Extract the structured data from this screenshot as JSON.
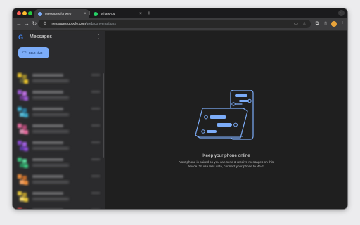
{
  "browser": {
    "tabs": [
      {
        "title": "Messages for web",
        "active": true,
        "favicon_color": "#7cacf8"
      },
      {
        "title": "WhatsApp",
        "active": false,
        "favicon_color": "#25d366"
      }
    ],
    "new_tab_icon": "+",
    "tab_menu_icon": "chevron-down-icon",
    "url_host": "messages.google.com",
    "url_path": "/web/conversations"
  },
  "app": {
    "logo": "G",
    "title": "Messages",
    "start_chat_label": "Start chat",
    "conversations": [
      {
        "colors": [
          "#e8c22b",
          "#a08a2a",
          "#5a5a3a"
        ]
      },
      {
        "colors": [
          "#9b59d0",
          "#c272e6",
          "#6a3a8a"
        ]
      },
      {
        "colors": [
          "#3aa7c8",
          "#2a7ca0",
          "#5abcd8"
        ]
      },
      {
        "colors": [
          "#e06a9a",
          "#b84a78",
          "#d890b0"
        ]
      },
      {
        "colors": [
          "#8a4ad0",
          "#a060e0",
          "#5a3aa0"
        ]
      },
      {
        "colors": [
          "#3abf7a",
          "#5ad89a",
          "#2a8a5a"
        ]
      },
      {
        "colors": [
          "#e88a3a",
          "#c06a2a",
          "#f0a060"
        ]
      },
      {
        "colors": [
          "#e8c83a",
          "#b89a2a",
          "#f0d870"
        ]
      },
      {
        "colors": [
          "#e84a4a",
          "#c03a3a",
          "#f07070"
        ]
      }
    ]
  },
  "empty_state": {
    "title": "Keep your phone online",
    "description_line1": "Your phone is paired so you can send & receive messages on this",
    "description_line2": "device. To use less data, connect your phone to Wi-Fi."
  },
  "colors": {
    "accent": "#7cacf8",
    "sidebar_bg": "#2b2b2d",
    "main_bg": "#1f1f1f"
  }
}
